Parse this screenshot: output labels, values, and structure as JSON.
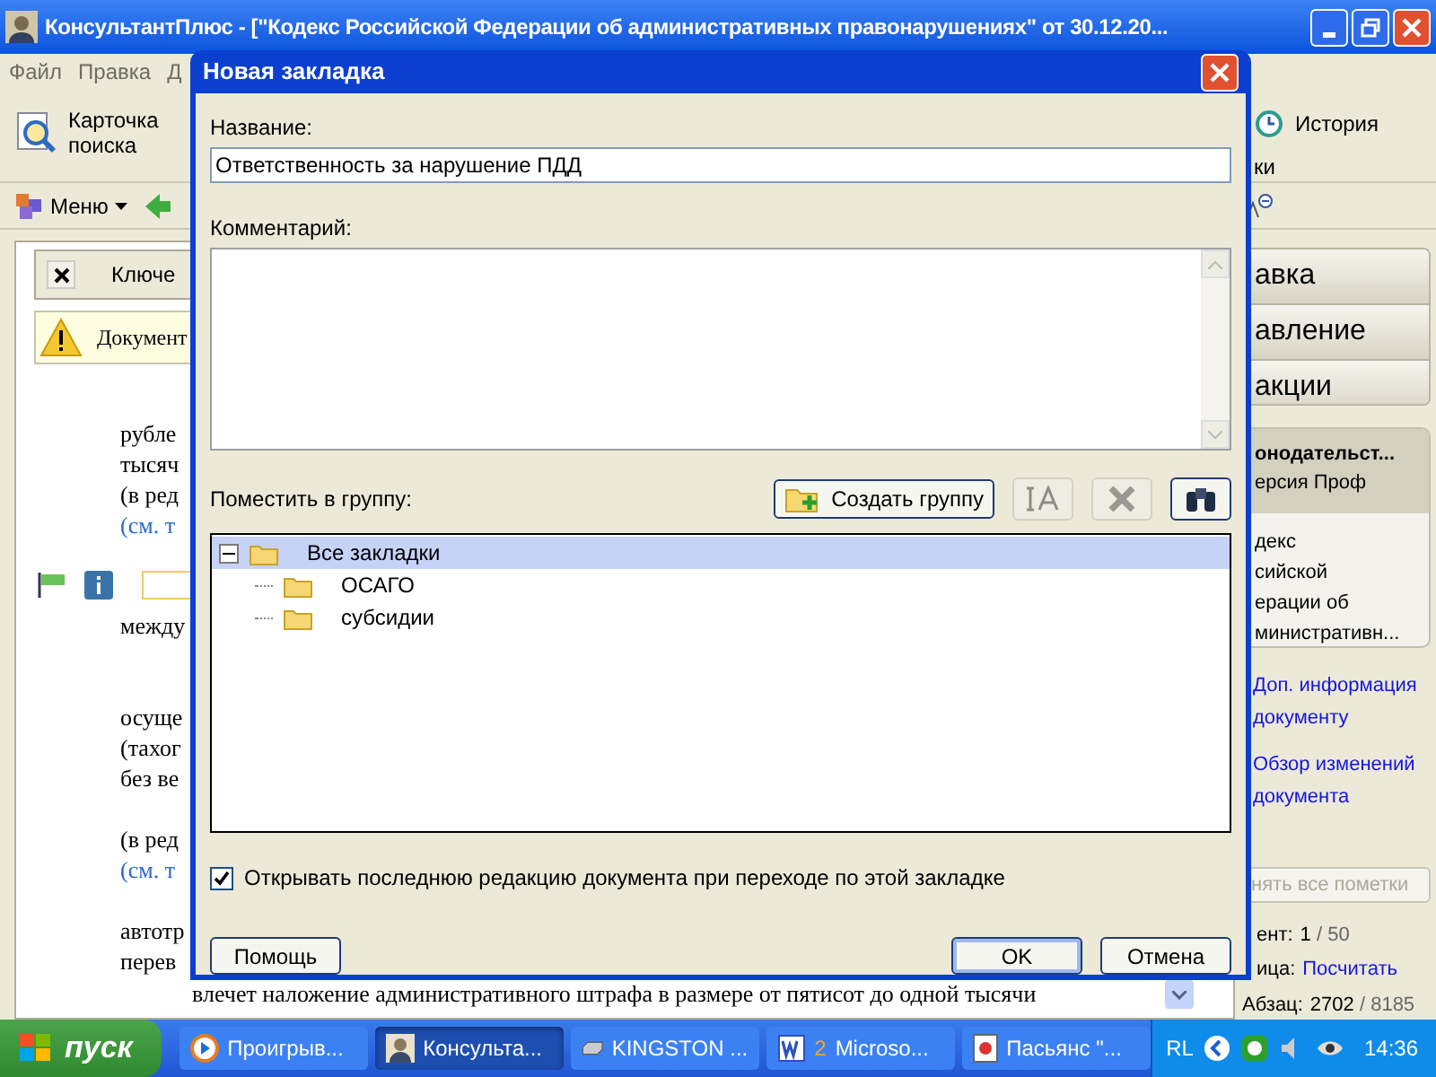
{
  "window": {
    "title": "КонсультантПлюс - [\"Кодекс Российской Федерации об административных правонарушениях\" от 30.12.20..."
  },
  "menu": [
    "Файл",
    "Правка",
    "Д"
  ],
  "toolbar": {
    "search_card": [
      "Карточка",
      "поиска"
    ],
    "history": "История",
    "fragment": "ки",
    "menu_button": "Меню"
  },
  "doc": {
    "close_bar_label": "Ключе",
    "warning": "Документ",
    "lines": [
      {
        "kind": "text",
        "text": "рубле"
      },
      {
        "kind": "text",
        "text": "тысяч"
      },
      {
        "kind": "text",
        "text": "(в ред"
      },
      {
        "kind": "link",
        "text": "(см. т"
      },
      {
        "kind": "blank"
      },
      {
        "kind": "markers"
      },
      {
        "kind": "text",
        "text": "между"
      },
      {
        "kind": "blank"
      },
      {
        "kind": "blank"
      },
      {
        "kind": "text",
        "text": "осуще"
      },
      {
        "kind": "text",
        "text": "(тахог"
      },
      {
        "kind": "text",
        "text": "без ве"
      },
      {
        "kind": "blank"
      },
      {
        "kind": "text",
        "text": "(в ред"
      },
      {
        "kind": "link",
        "text": "(см. т"
      },
      {
        "kind": "blank"
      },
      {
        "kind": "text",
        "text": "автотр"
      },
      {
        "kind": "text",
        "text": "перев"
      }
    ],
    "bottom_line": "влечет наложение административного штрафа в размере от пятисот до одной тысячи"
  },
  "right_panel": {
    "tabs": [
      "авка",
      "авление",
      "акции"
    ],
    "card": {
      "title": "онодательст...",
      "subtitle": "ерсия Проф",
      "lines": [
        "декс",
        "сийской",
        "ерации об",
        "министративн..."
      ]
    },
    "links": [
      {
        "lines": [
          "Доп. информация",
          "документу"
        ]
      },
      {
        "lines": [
          "Обзор изменений",
          "документа"
        ]
      }
    ],
    "clear_button": {
      "label": "нять все пометки",
      "disabled": true
    },
    "stats": [
      {
        "label": "ент:",
        "value": "1",
        "total": "/ 50",
        "kind": "count"
      },
      {
        "label": "ица:",
        "value": "Посчитать",
        "kind": "link"
      },
      {
        "label": "Абзац:",
        "value": "2702",
        "total": "/ 8185",
        "kind": "count"
      }
    ]
  },
  "dialog": {
    "title": "Новая закладка",
    "name_label": "Название:",
    "name_value": "Ответственность за нарушение ПДД",
    "comment_label": "Комментарий:",
    "group_label": "Поместить в группу:",
    "create_group": "Создать группу",
    "tool_buttons": [
      {
        "kind": "rename",
        "disabled": true
      },
      {
        "kind": "delete",
        "disabled": true
      },
      {
        "kind": "find",
        "disabled": false
      }
    ],
    "tree": [
      {
        "label": "Все закладки",
        "expanded": true,
        "selected": true,
        "children": [
          {
            "label": "ОСАГО",
            "selected": false
          },
          {
            "label": "субсидии",
            "selected": false
          }
        ]
      }
    ],
    "open_latest": {
      "label": "Открывать последнюю редакцию документа при переходе по этой закладке",
      "checked": true
    },
    "buttons": [
      {
        "label": "Помощь",
        "default": false
      },
      {
        "label": "OK",
        "default": true
      },
      {
        "label": "Отмена",
        "default": false
      }
    ]
  },
  "taskbar": {
    "start": "пуск",
    "items": [
      {
        "kind": "media",
        "label": "Проигрыв...",
        "selected": false
      },
      {
        "kind": "consultant",
        "label": "Консульта...",
        "selected": true
      },
      {
        "kind": "drive",
        "label": "KINGSTON ...",
        "selected": false
      },
      {
        "kind": "word",
        "count": "2",
        "label": "Microso...",
        "selected": false
      },
      {
        "kind": "solitaire",
        "label": "Пасьянс \"...",
        "selected": false
      }
    ],
    "language": "RL",
    "clock": "14:36"
  }
}
